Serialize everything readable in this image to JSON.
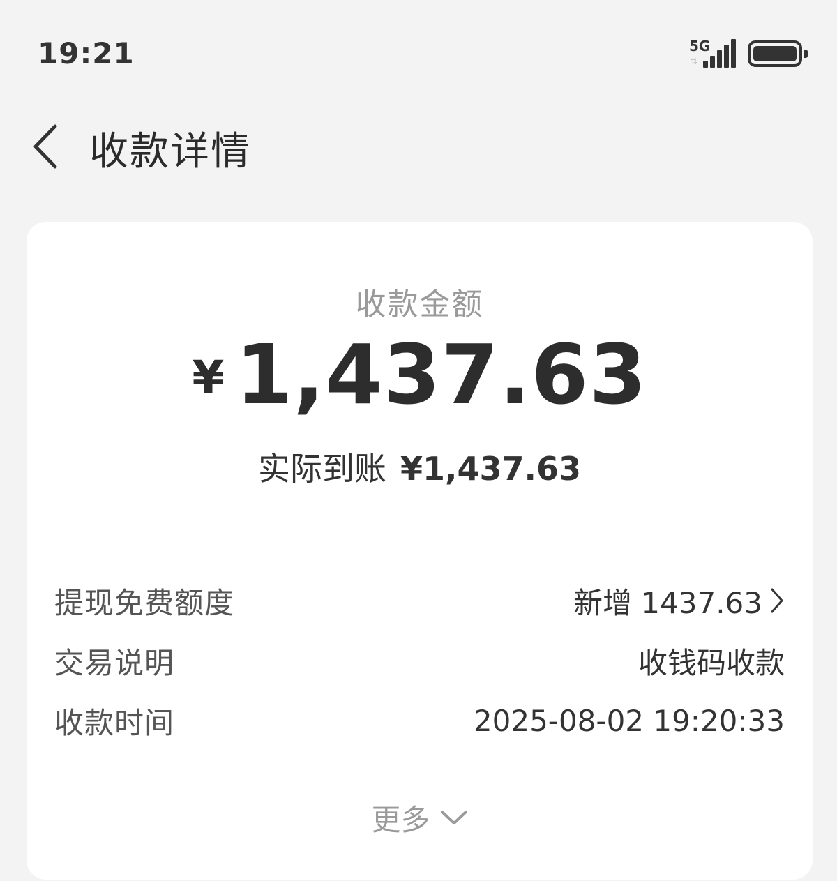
{
  "status_bar": {
    "time": "19:21",
    "network_type": "5G",
    "network_arrows": "⇅",
    "signal_icon": "signal-icon",
    "battery_icon": "battery-icon"
  },
  "header": {
    "back_icon": "back-arrow-icon",
    "title": "收款详情"
  },
  "summary": {
    "amount_label": "收款金额",
    "currency_symbol": "¥",
    "amount": "1,437.63",
    "received_label": "实际到账",
    "received_amount": "¥1,437.63"
  },
  "details": [
    {
      "label": "提现免费额度",
      "value": "新增 1437.63",
      "has_chevron": true
    },
    {
      "label": "交易说明",
      "value": "收钱码收款",
      "has_chevron": false
    },
    {
      "label": "收款时间",
      "value": "2025-08-02 19:20:33",
      "has_chevron": false
    }
  ],
  "more": {
    "label": "更多",
    "icon": "chevron-down-icon"
  },
  "colors": {
    "page_background": "#f3f3f3",
    "card_background": "#ffffff",
    "primary_text": "#333333",
    "secondary_text": "#9a9a9a"
  }
}
